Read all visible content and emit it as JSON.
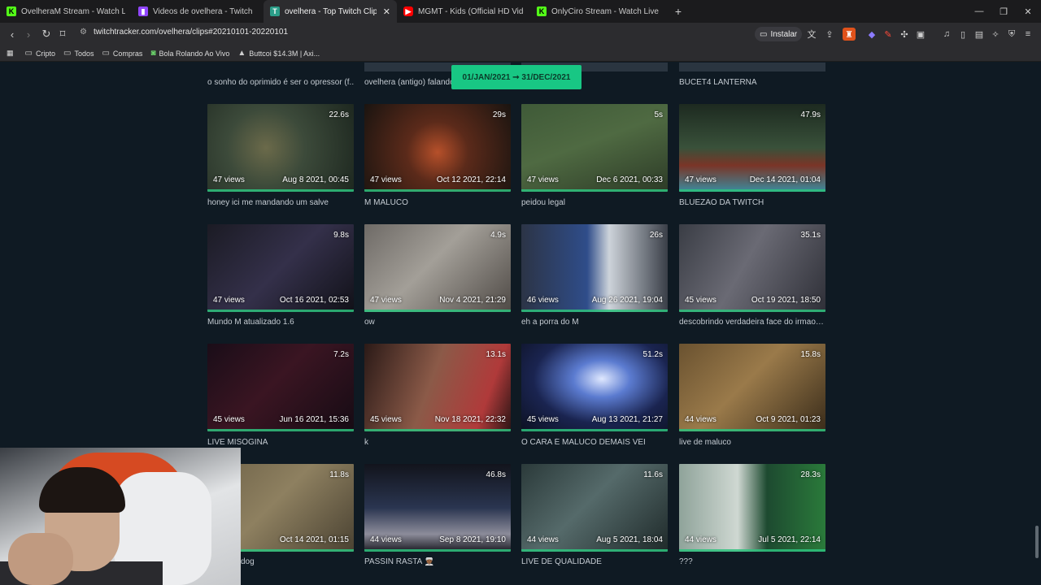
{
  "tabs": [
    {
      "icon": "kick",
      "title": "OvelheraM Stream - Watch Live on K",
      "active": false
    },
    {
      "icon": "twitch",
      "title": "Videos de ovelhera - Twitch",
      "active": false
    },
    {
      "icon": "tt",
      "title": "ovelhera - Top Twitch Clips - Twi",
      "active": true
    },
    {
      "icon": "yt",
      "title": "MGMT - Kids (Official HD Video) - Yo",
      "active": false
    },
    {
      "icon": "kick",
      "title": "OnlyCiro Stream - Watch Live on Kick",
      "active": false
    }
  ],
  "toolbar": {
    "url": "twitchtracker.com/ovelhera/clips#20210101-20220101",
    "install_label": "Instalar"
  },
  "bookmarks": [
    {
      "icon": "folder-icon",
      "label": "Cripto"
    },
    {
      "icon": "folder-icon",
      "label": "Todos"
    },
    {
      "icon": "folder-icon",
      "label": "Compras"
    },
    {
      "icon": "site-icon",
      "label": "Bola Rolando Ao Vivo"
    },
    {
      "icon": "triangle-icon",
      "label": "Buttcoi $14.3M | Axi..."
    }
  ],
  "date_range": "01/JAN/2021 ➞ 31/DEC/2021",
  "top_row_titles": [
    "o sonho do oprimido é ser o opressor (f...",
    "ovelhera (antigo) falando",
    "",
    "BUCET4 LANTERNA"
  ],
  "clips": [
    {
      "duration": "22.6s",
      "views": "47 views",
      "date": "Aug 8 2021, 00:45",
      "title": "honey ici me mandando um salve"
    },
    {
      "duration": "29s",
      "views": "47 views",
      "date": "Oct 12 2021, 22:14",
      "title": "M MALUCO"
    },
    {
      "duration": "5s",
      "views": "47 views",
      "date": "Dec 6 2021, 00:33",
      "title": "peidou legal"
    },
    {
      "duration": "47.9s",
      "views": "47 views",
      "date": "Dec 14 2021, 01:04",
      "title": "BLUEZÃO DA TWITCH"
    },
    {
      "duration": "9.8s",
      "views": "47 views",
      "date": "Oct 16 2021, 02:53",
      "title": "Mundo M atualizado 1.6"
    },
    {
      "duration": "4.9s",
      "views": "47 views",
      "date": "Nov 4 2021, 21:29",
      "title": "ow"
    },
    {
      "duration": "26s",
      "views": "46 views",
      "date": "Aug 26 2021, 19:04",
      "title": "eh a porra do M"
    },
    {
      "duration": "35.1s",
      "views": "45 views",
      "date": "Oct 19 2021, 18:50",
      "title": "descobrindo verdadeira face do irmao c..."
    },
    {
      "duration": "7.2s",
      "views": "45 views",
      "date": "Jun 16 2021, 15:36",
      "title": "LIVE MISÓGINA"
    },
    {
      "duration": "13.1s",
      "views": "45 views",
      "date": "Nov 18 2021, 22:32",
      "title": "k"
    },
    {
      "duration": "51.2s",
      "views": "45 views",
      "date": "Aug 13 2021, 21:27",
      "title": "O CARA É MALUCO DEMAIS VEI"
    },
    {
      "duration": "15.8s",
      "views": "44 views",
      "date": "Oct 9 2021, 01:23",
      "title": "live de maluco"
    },
    {
      "duration": "11.8s",
      "views": "",
      "date": "Oct 14 2021, 01:15",
      "title": "dog"
    },
    {
      "duration": "46.8s",
      "views": "44 views",
      "date": "Sep 8 2021, 19:10",
      "title": "PASSIN RASTA 👳🏾"
    },
    {
      "duration": "11.6s",
      "views": "44 views",
      "date": "Aug 5 2021, 18:04",
      "title": "LIVE DE QUALIDADE"
    },
    {
      "duration": "28.3s",
      "views": "44 views",
      "date": "Jul 5 2021, 22:14",
      "title": "???"
    }
  ]
}
